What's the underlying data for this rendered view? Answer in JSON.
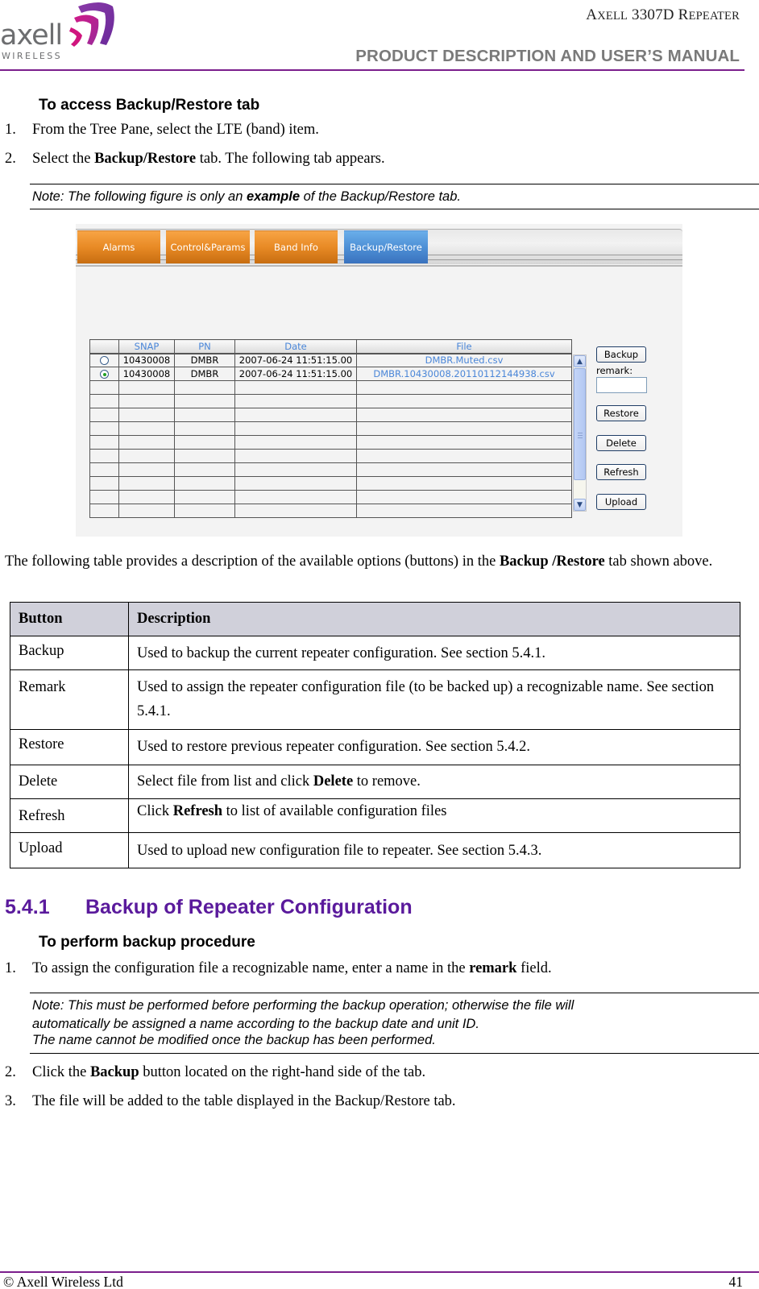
{
  "header": {
    "brand_word": "axell",
    "brand_sub": "WIRELESS",
    "product_title_a": "A",
    "product_title_b": "XELL",
    "product_title_c": " 3307D R",
    "product_title_d": "EPEATER",
    "manual_title": "PRODUCT DESCRIPTION AND USER’S MANUAL",
    "colors": {
      "accent": "#7b1e8c",
      "heading": "#5a1a9c"
    }
  },
  "access_section": {
    "title": "To access Backup/Restore tab",
    "steps": [
      {
        "num": "1.",
        "pre": "From the Tree Pane, select the LTE (band) item.",
        "bold": "",
        "post": ""
      },
      {
        "num": "2.",
        "pre": "Select the ",
        "bold": "Backup/Restore",
        "post": " tab. The following tab appears."
      }
    ],
    "note": {
      "pre": "Note: The following figure is only an ",
      "bold": "example",
      "post": " of the Backup/Restore tab."
    }
  },
  "screenshot": {
    "tabs": [
      {
        "label": "Alarms",
        "active": false
      },
      {
        "label": "Control&Params",
        "active": false
      },
      {
        "label": "Band Info",
        "active": false
      },
      {
        "label": "Backup/Restore",
        "active": true
      }
    ],
    "table": {
      "columns": [
        "",
        "SNAP",
        "PN",
        "Date",
        "File"
      ],
      "rows": [
        {
          "selected": false,
          "snap": "10430008",
          "pn": "DMBR",
          "date": "2007-06-24 11:51:15.00",
          "file": "DMBR.Muted.csv"
        },
        {
          "selected": true,
          "snap": "10430008",
          "pn": "DMBR",
          "date": "2007-06-24 11:51:15.00",
          "file": "DMBR.10430008.20110112144938.csv"
        }
      ],
      "empty_rows": 10
    },
    "buttons": {
      "backup": "Backup",
      "remark_label": "remark:",
      "remark_value": "",
      "restore": "Restore",
      "delete": "Delete",
      "refresh": "Refresh",
      "upload": "Upload"
    },
    "colors": {
      "tab_orange": "#e88a25",
      "tab_blue": "#4e90d6",
      "header_text": "#4a86d8"
    }
  },
  "intro_paragraph": {
    "pre": "The following table provides a description of the available options (buttons) in the ",
    "bold": "Backup /Restore",
    "post": " tab shown above."
  },
  "description_table": {
    "headers": [
      "Button",
      "Description"
    ],
    "rows": [
      {
        "button": "Backup",
        "pre": "Used to backup the current repeater configuration. See section 5.4.1.",
        "bold": "",
        "post": ""
      },
      {
        "button": "Remark",
        "pre": "Used to assign the repeater configuration file (to be backed up) a recognizable name. See section 5.4.1.",
        "bold": "",
        "post": ""
      },
      {
        "button": "Restore",
        "pre": "Used to restore previous repeater configuration. See section 5.4.2.",
        "bold": "",
        "post": ""
      },
      {
        "button": "Delete",
        "pre": "Select file from list and click ",
        "bold": "Delete",
        "post": " to remove."
      },
      {
        "button": "Refresh",
        "pre": "Click ",
        "bold": "Refresh",
        "post": " to list of available configuration files"
      },
      {
        "button": "Upload",
        "pre": "Used to upload new configuration file to repeater. See section 5.4.3.",
        "bold": "",
        "post": ""
      }
    ]
  },
  "section_541": {
    "number": "5.4.1",
    "title": "Backup of Repeater Configuration",
    "procedure_title": "To perform backup procedure",
    "step1": {
      "num": "1.",
      "pre": "To assign the configuration file a recognizable name, enter a name in the ",
      "bold": "remark",
      "post": " field."
    },
    "note_lines": [
      "Note: This must be performed before performing the backup operation; otherwise the file will",
      "automatically be assigned a name according to the backup date and unit ID.",
      "The name cannot be modified once the backup has been performed."
    ],
    "step2": {
      "num": "2.",
      "pre": "Click the ",
      "bold": "Backup",
      "post": " button located on the right-hand side of the tab."
    },
    "step3": {
      "num": "3.",
      "pre": "The file will be added to the table displayed in the Backup/Restore tab.",
      "bold": "",
      "post": ""
    }
  },
  "footer": {
    "copyright": "© Axell Wireless Ltd",
    "page_number": "41"
  }
}
